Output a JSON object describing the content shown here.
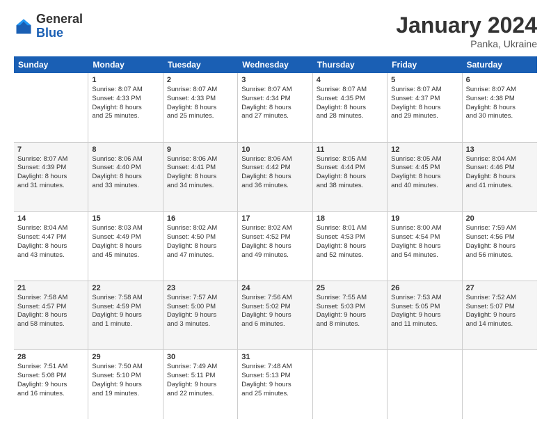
{
  "header": {
    "logo": {
      "general": "General",
      "blue": "Blue"
    },
    "title": "January 2024",
    "subtitle": "Panka, Ukraine"
  },
  "calendar": {
    "days_of_week": [
      "Sunday",
      "Monday",
      "Tuesday",
      "Wednesday",
      "Thursday",
      "Friday",
      "Saturday"
    ],
    "weeks": [
      [
        {
          "day": "",
          "info": []
        },
        {
          "day": "1",
          "info": [
            "Sunrise: 8:07 AM",
            "Sunset: 4:33 PM",
            "Daylight: 8 hours",
            "and 25 minutes."
          ]
        },
        {
          "day": "2",
          "info": [
            "Sunrise: 8:07 AM",
            "Sunset: 4:33 PM",
            "Daylight: 8 hours",
            "and 25 minutes."
          ]
        },
        {
          "day": "3",
          "info": [
            "Sunrise: 8:07 AM",
            "Sunset: 4:34 PM",
            "Daylight: 8 hours",
            "and 27 minutes."
          ]
        },
        {
          "day": "4",
          "info": [
            "Sunrise: 8:07 AM",
            "Sunset: 4:35 PM",
            "Daylight: 8 hours",
            "and 28 minutes."
          ]
        },
        {
          "day": "5",
          "info": [
            "Sunrise: 8:07 AM",
            "Sunset: 4:37 PM",
            "Daylight: 8 hours",
            "and 29 minutes."
          ]
        },
        {
          "day": "6",
          "info": [
            "Sunrise: 8:07 AM",
            "Sunset: 4:38 PM",
            "Daylight: 8 hours",
            "and 30 minutes."
          ]
        }
      ],
      [
        {
          "day": "7",
          "info": [
            "Sunrise: 8:07 AM",
            "Sunset: 4:39 PM",
            "Daylight: 8 hours",
            "and 31 minutes."
          ]
        },
        {
          "day": "8",
          "info": [
            "Sunrise: 8:06 AM",
            "Sunset: 4:40 PM",
            "Daylight: 8 hours",
            "and 33 minutes."
          ]
        },
        {
          "day": "9",
          "info": [
            "Sunrise: 8:06 AM",
            "Sunset: 4:41 PM",
            "Daylight: 8 hours",
            "and 34 minutes."
          ]
        },
        {
          "day": "10",
          "info": [
            "Sunrise: 8:06 AM",
            "Sunset: 4:42 PM",
            "Daylight: 8 hours",
            "and 36 minutes."
          ]
        },
        {
          "day": "11",
          "info": [
            "Sunrise: 8:05 AM",
            "Sunset: 4:44 PM",
            "Daylight: 8 hours",
            "and 38 minutes."
          ]
        },
        {
          "day": "12",
          "info": [
            "Sunrise: 8:05 AM",
            "Sunset: 4:45 PM",
            "Daylight: 8 hours",
            "and 40 minutes."
          ]
        },
        {
          "day": "13",
          "info": [
            "Sunrise: 8:04 AM",
            "Sunset: 4:46 PM",
            "Daylight: 8 hours",
            "and 41 minutes."
          ]
        }
      ],
      [
        {
          "day": "14",
          "info": [
            "Sunrise: 8:04 AM",
            "Sunset: 4:47 PM",
            "Daylight: 8 hours",
            "and 43 minutes."
          ]
        },
        {
          "day": "15",
          "info": [
            "Sunrise: 8:03 AM",
            "Sunset: 4:49 PM",
            "Daylight: 8 hours",
            "and 45 minutes."
          ]
        },
        {
          "day": "16",
          "info": [
            "Sunrise: 8:02 AM",
            "Sunset: 4:50 PM",
            "Daylight: 8 hours",
            "and 47 minutes."
          ]
        },
        {
          "day": "17",
          "info": [
            "Sunrise: 8:02 AM",
            "Sunset: 4:52 PM",
            "Daylight: 8 hours",
            "and 49 minutes."
          ]
        },
        {
          "day": "18",
          "info": [
            "Sunrise: 8:01 AM",
            "Sunset: 4:53 PM",
            "Daylight: 8 hours",
            "and 52 minutes."
          ]
        },
        {
          "day": "19",
          "info": [
            "Sunrise: 8:00 AM",
            "Sunset: 4:54 PM",
            "Daylight: 8 hours",
            "and 54 minutes."
          ]
        },
        {
          "day": "20",
          "info": [
            "Sunrise: 7:59 AM",
            "Sunset: 4:56 PM",
            "Daylight: 8 hours",
            "and 56 minutes."
          ]
        }
      ],
      [
        {
          "day": "21",
          "info": [
            "Sunrise: 7:58 AM",
            "Sunset: 4:57 PM",
            "Daylight: 8 hours",
            "and 58 minutes."
          ]
        },
        {
          "day": "22",
          "info": [
            "Sunrise: 7:58 AM",
            "Sunset: 4:59 PM",
            "Daylight: 9 hours",
            "and 1 minute."
          ]
        },
        {
          "day": "23",
          "info": [
            "Sunrise: 7:57 AM",
            "Sunset: 5:00 PM",
            "Daylight: 9 hours",
            "and 3 minutes."
          ]
        },
        {
          "day": "24",
          "info": [
            "Sunrise: 7:56 AM",
            "Sunset: 5:02 PM",
            "Daylight: 9 hours",
            "and 6 minutes."
          ]
        },
        {
          "day": "25",
          "info": [
            "Sunrise: 7:55 AM",
            "Sunset: 5:03 PM",
            "Daylight: 9 hours",
            "and 8 minutes."
          ]
        },
        {
          "day": "26",
          "info": [
            "Sunrise: 7:53 AM",
            "Sunset: 5:05 PM",
            "Daylight: 9 hours",
            "and 11 minutes."
          ]
        },
        {
          "day": "27",
          "info": [
            "Sunrise: 7:52 AM",
            "Sunset: 5:07 PM",
            "Daylight: 9 hours",
            "and 14 minutes."
          ]
        }
      ],
      [
        {
          "day": "28",
          "info": [
            "Sunrise: 7:51 AM",
            "Sunset: 5:08 PM",
            "Daylight: 9 hours",
            "and 16 minutes."
          ]
        },
        {
          "day": "29",
          "info": [
            "Sunrise: 7:50 AM",
            "Sunset: 5:10 PM",
            "Daylight: 9 hours",
            "and 19 minutes."
          ]
        },
        {
          "day": "30",
          "info": [
            "Sunrise: 7:49 AM",
            "Sunset: 5:11 PM",
            "Daylight: 9 hours",
            "and 22 minutes."
          ]
        },
        {
          "day": "31",
          "info": [
            "Sunrise: 7:48 AM",
            "Sunset: 5:13 PM",
            "Daylight: 9 hours",
            "and 25 minutes."
          ]
        },
        {
          "day": "",
          "info": []
        },
        {
          "day": "",
          "info": []
        },
        {
          "day": "",
          "info": []
        }
      ]
    ]
  }
}
